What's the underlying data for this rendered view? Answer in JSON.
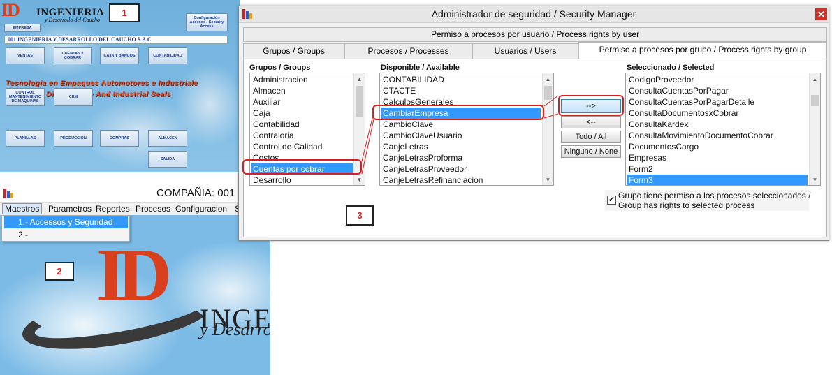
{
  "colors": {
    "selection": "#3399ff",
    "highlight_red": "#d42020",
    "brand_red": "#d9401d",
    "sky_blue": "#7cbbe6"
  },
  "panel1": {
    "tag": "1",
    "brand": "INGENIERIA",
    "brand_sub": "y Desarrollo del Caucho",
    "empresa_btn": "EMPRESA",
    "config_btn": "Configuración Accesos / Security Access",
    "company_name": "001 INGENIERIA Y DESARROLLO DEL CAUCHO S.A.C",
    "slogan_line1": "Tecnologia en Empaques Automotores e Industriale",
    "slogan_line2": "Di           utomotive And Industrial Seals",
    "buttons": {
      "ventas": "VENTAS",
      "cuentas": "CUENTAS x COBRAR",
      "caja": "CAJA Y BANCOS",
      "contabilidad": "CONTABILIDAD",
      "control": "CONTROL MANTENIMIENTO DE MAQUINAS",
      "crm": "CRM",
      "planillas": "PLANILLAS",
      "produccion": "PRODUCCION",
      "compras": "COMPRAS",
      "almacen": "ALMACEN",
      "salida": "SALIDA"
    }
  },
  "panel2": {
    "tag": "2",
    "title": "COMPAÑIA:  001 IN",
    "menus": [
      "Maestros",
      "Parametros",
      "Reportes",
      "Procesos",
      "Configuracion",
      "S"
    ],
    "dropdown": [
      "1.- Accessos y Seguridad",
      "2.-"
    ],
    "logo_letters": "ID",
    "brand_line1": "INGE",
    "brand_line2": "y Desarro"
  },
  "panel3": {
    "tag": "3",
    "title": "Administrador de seguridad / Security Manager",
    "close": "✕",
    "top_tab": "Permiso a procesos por usuario / Process rights by user",
    "tabs": [
      "Grupos / Groups",
      "Procesos / Processes",
      "Usuarios / Users",
      "Permiso a procesos por  grupo / Process rights by group"
    ],
    "groups_label": "Grupos / Groups",
    "available_label": "Disponible / Available",
    "selected_label": "Seleccionado / Selected",
    "groups": [
      "Administracion",
      "Almacen",
      "Auxiliar",
      "Caja",
      "Contabilidad",
      "Contraloria",
      "Control de Calidad",
      "Costos",
      "Cuentas por cobrar",
      "Desarrollo"
    ],
    "available": [
      "CONTABILIDAD",
      "CTACTE",
      "CalculosGenerales",
      "CambiarEmpresa",
      "CambioClave",
      "CambioClaveUsuario",
      "CanjeLetras",
      "CanjeLetrasProforma",
      "CanjeLetrasProveedor",
      "CanjeLetrasRefinanciacion"
    ],
    "selected": [
      "CodigoProveedor",
      "ConsultaCuentasPorPagar",
      "ConsultaCuentasPorPagarDetalle",
      "ConsultaDocumentosxCobrar",
      "ConsultaKardex",
      "ConsultaMovimientoDocumentoCobrar",
      "DocumentosCargo",
      "Empresas",
      "Form2",
      "Form3"
    ],
    "btn_add": "-->",
    "btn_remove": "<--",
    "btn_all": "Todo / All",
    "btn_none": "Ninguno / None",
    "checkbox_mark": "✓",
    "checkbox_label_1": "Grupo tiene permiso a los procesos seleccionados /",
    "checkbox_label_2": "Group has rights to selected process"
  }
}
